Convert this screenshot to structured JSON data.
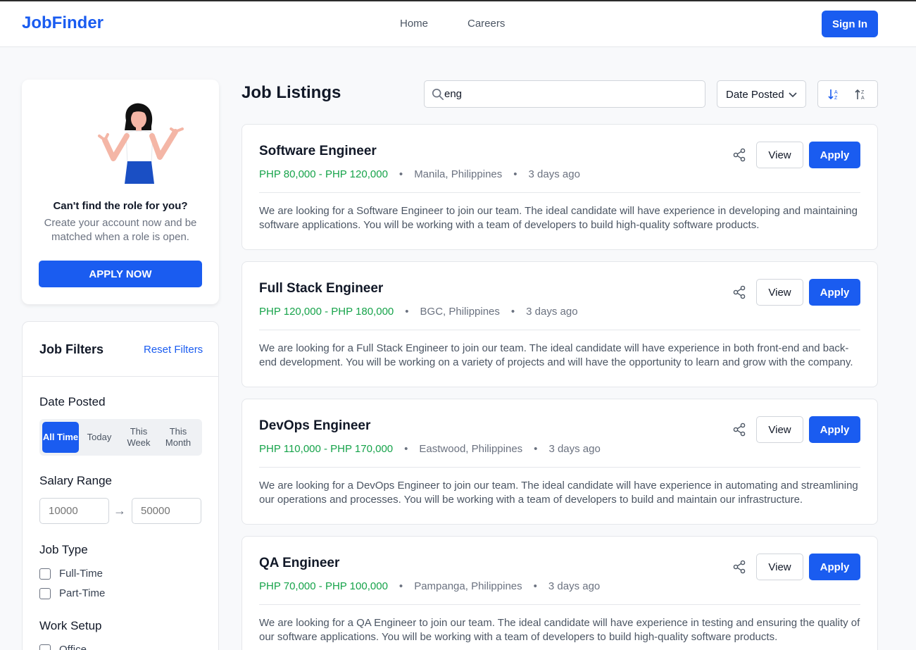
{
  "app": {
    "logo": "JobFinder"
  },
  "header": {
    "nav": [
      "Home",
      "Careers"
    ],
    "signin": "Sign In"
  },
  "promo": {
    "title": "Can't find the role for you?",
    "text": "Create your account now and be matched when a role is open.",
    "cta": "APPLY NOW"
  },
  "filters": {
    "title": "Job Filters",
    "reset": "Reset Filters",
    "date_label": "Date Posted",
    "date_options": [
      "All Time",
      "Today",
      "This Week",
      "This Month"
    ],
    "date_selected": "All Time",
    "salary_label": "Salary Range",
    "salary_min_placeholder": "10000",
    "salary_max_placeholder": "50000",
    "arrow": "→",
    "type_label": "Job Type",
    "types": [
      "Full-Time",
      "Part-Time"
    ],
    "setup_label": "Work Setup",
    "setups": [
      "Office"
    ]
  },
  "main": {
    "title": "Job Listings",
    "search_value": "eng",
    "sort_value": "Date Posted"
  },
  "jobs": [
    {
      "title": "Software Engineer",
      "salary": "PHP 80,000 - PHP 120,000",
      "location": "Manila, Philippines",
      "posted": "3 days ago",
      "view": "View",
      "apply": "Apply",
      "description": "We are looking for a Software Engineer to join our team. The ideal candidate will have experience in developing and maintaining software applications. You will be working with a team of developers to build high-quality software products."
    },
    {
      "title": "Full Stack Engineer",
      "salary": "PHP 120,000 - PHP 180,000",
      "location": "BGC, Philippines",
      "posted": "3 days ago",
      "view": "View",
      "apply": "Apply",
      "description": "We are looking for a Full Stack Engineer to join our team. The ideal candidate will have experience in both front-end and back-end development. You will be working on a variety of projects and will have the opportunity to learn and grow with the company."
    },
    {
      "title": "DevOps Engineer",
      "salary": "PHP 110,000 - PHP 170,000",
      "location": "Eastwood, Philippines",
      "posted": "3 days ago",
      "view": "View",
      "apply": "Apply",
      "description": "We are looking for a DevOps Engineer to join our team. The ideal candidate will have experience in automating and streamlining our operations and processes. You will be working with a team of developers to build and maintain our infrastructure."
    },
    {
      "title": "QA Engineer",
      "salary": "PHP 70,000 - PHP 100,000",
      "location": "Pampanga, Philippines",
      "posted": "3 days ago",
      "view": "View",
      "apply": "Apply",
      "description": "We are looking for a QA Engineer to join our team. The ideal candidate will have experience in testing and ensuring the quality of our software applications. You will be working with a team of developers to build high-quality software products."
    }
  ],
  "colors": {
    "brand": "#1a5cf0",
    "salary": "#16a34a"
  },
  "icons": [
    "search-icon",
    "chevron-down-icon",
    "sort-ascending-icon",
    "sort-descending-icon",
    "share-icon",
    "woman-shrugging-illustration"
  ]
}
